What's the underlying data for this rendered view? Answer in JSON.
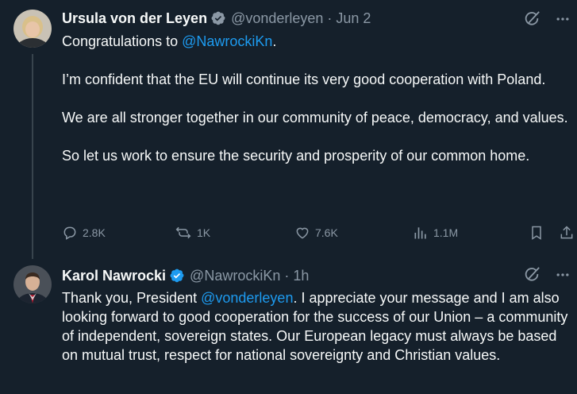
{
  "tweet1": {
    "name": "Ursula von der Leyen",
    "handle": "@vonderleyen",
    "dot": "·",
    "time": "Jun 2",
    "body": {
      "p1_prefix": "Congratulations to ",
      "p1_mention": "@NawrockiKn",
      "p1_suffix": ".",
      "p2": "I’m confident that the EU will continue its very good cooperation with Poland.",
      "p3": "We are all stronger together in our community of peace, democracy, and values.",
      "p4": "So let us work to ensure the security and prosperity of our common home."
    },
    "actions": {
      "replies": "2.8K",
      "reposts": "1K",
      "likes": "7.6K",
      "views": "1.1M"
    }
  },
  "tweet2": {
    "name": "Karol Nawrocki",
    "handle": "@NawrockiKn",
    "dot": "·",
    "time": "1h",
    "body": {
      "prefix": "Thank you, President ",
      "mention": "@vonderleyen",
      "suffix": ". I appreciate your message and I am also looking forward to good cooperation for the success of our Union – a community of independent, sovereign states. Our European legacy must always be based on mutual trust, respect for national sovereignty and Christian values."
    }
  },
  "colors": {
    "background": "#15202b",
    "text": "#f7f9f9",
    "secondary": "#8b98a5",
    "accent": "#1d9bf0",
    "verified_badge": "#1d9bf0"
  },
  "icons": [
    "verified-badge-icon",
    "grok-icon",
    "more-icon",
    "reply-icon",
    "repost-icon",
    "like-icon",
    "views-icon",
    "bookmark-icon",
    "share-icon"
  ]
}
